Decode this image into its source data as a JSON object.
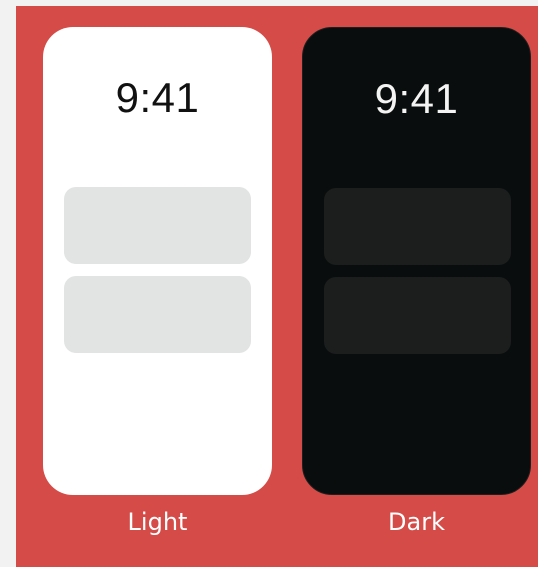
{
  "colors": {
    "background": "#d44b47",
    "outer_margin": "#f2f2f2",
    "light_screen": "#ffffff",
    "light_card": "#e2e3e3",
    "light_text": "#111111",
    "dark_screen": "#0a0d0d",
    "dark_card": "#1c1e1e",
    "dark_text": "#f4f4f4",
    "label_text": "#ffffff"
  },
  "light_mode": {
    "time": "9:41",
    "label": "Light"
  },
  "dark_mode": {
    "time": "9:41",
    "label": "Dark"
  }
}
